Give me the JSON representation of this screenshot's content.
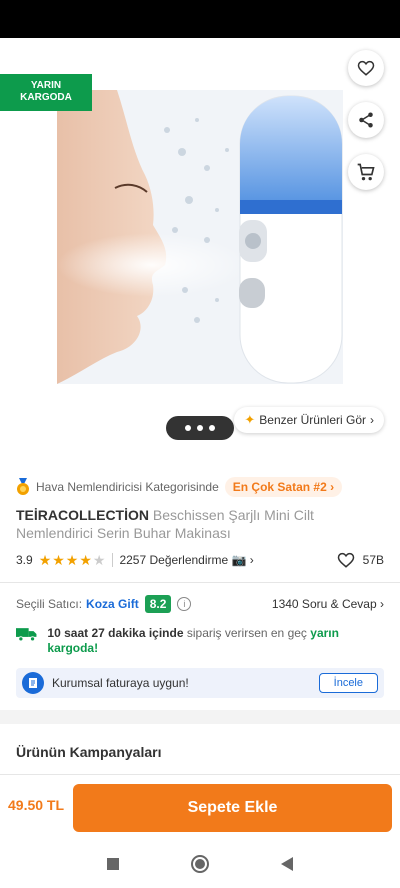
{
  "badge": {
    "line1": "YARIN",
    "line2": "KARGODA"
  },
  "similar_products_label": "Benzer Ürünleri Gör",
  "category": {
    "text": "Hava Nemlendiricisi Kategorisinde",
    "rank_badge": "En Çok Satan #2"
  },
  "product": {
    "brand": "TEİRACOLLECTİON",
    "name": "Beschissen Şarjlı Mini Cilt Nemlendirici Serin Buhar Makinası"
  },
  "rating": {
    "score": "3.9",
    "stars": 4,
    "reviews_text": "2257 Değerlendirme",
    "favorites": "57B"
  },
  "seller": {
    "label": "Seçili Satıcı:",
    "name": "Koza Gift",
    "score": "8.2",
    "qa_text": "1340 Soru & Cevap"
  },
  "delivery": {
    "time": "10 saat 27 dakika içinde",
    "middle": "sipariş verirsen en geç",
    "tail": "yarın kargoda!"
  },
  "corporate": {
    "text": "Kurumsal faturaya uygun!",
    "button": "İncele"
  },
  "campaigns_title": "Ürünün Kampanyaları",
  "price": "49.50 TL",
  "add_to_cart": "Sepete Ekle",
  "colors": {
    "accent": "#f27a1a",
    "green": "#0d9b4c",
    "blue": "#1a6bd8"
  }
}
